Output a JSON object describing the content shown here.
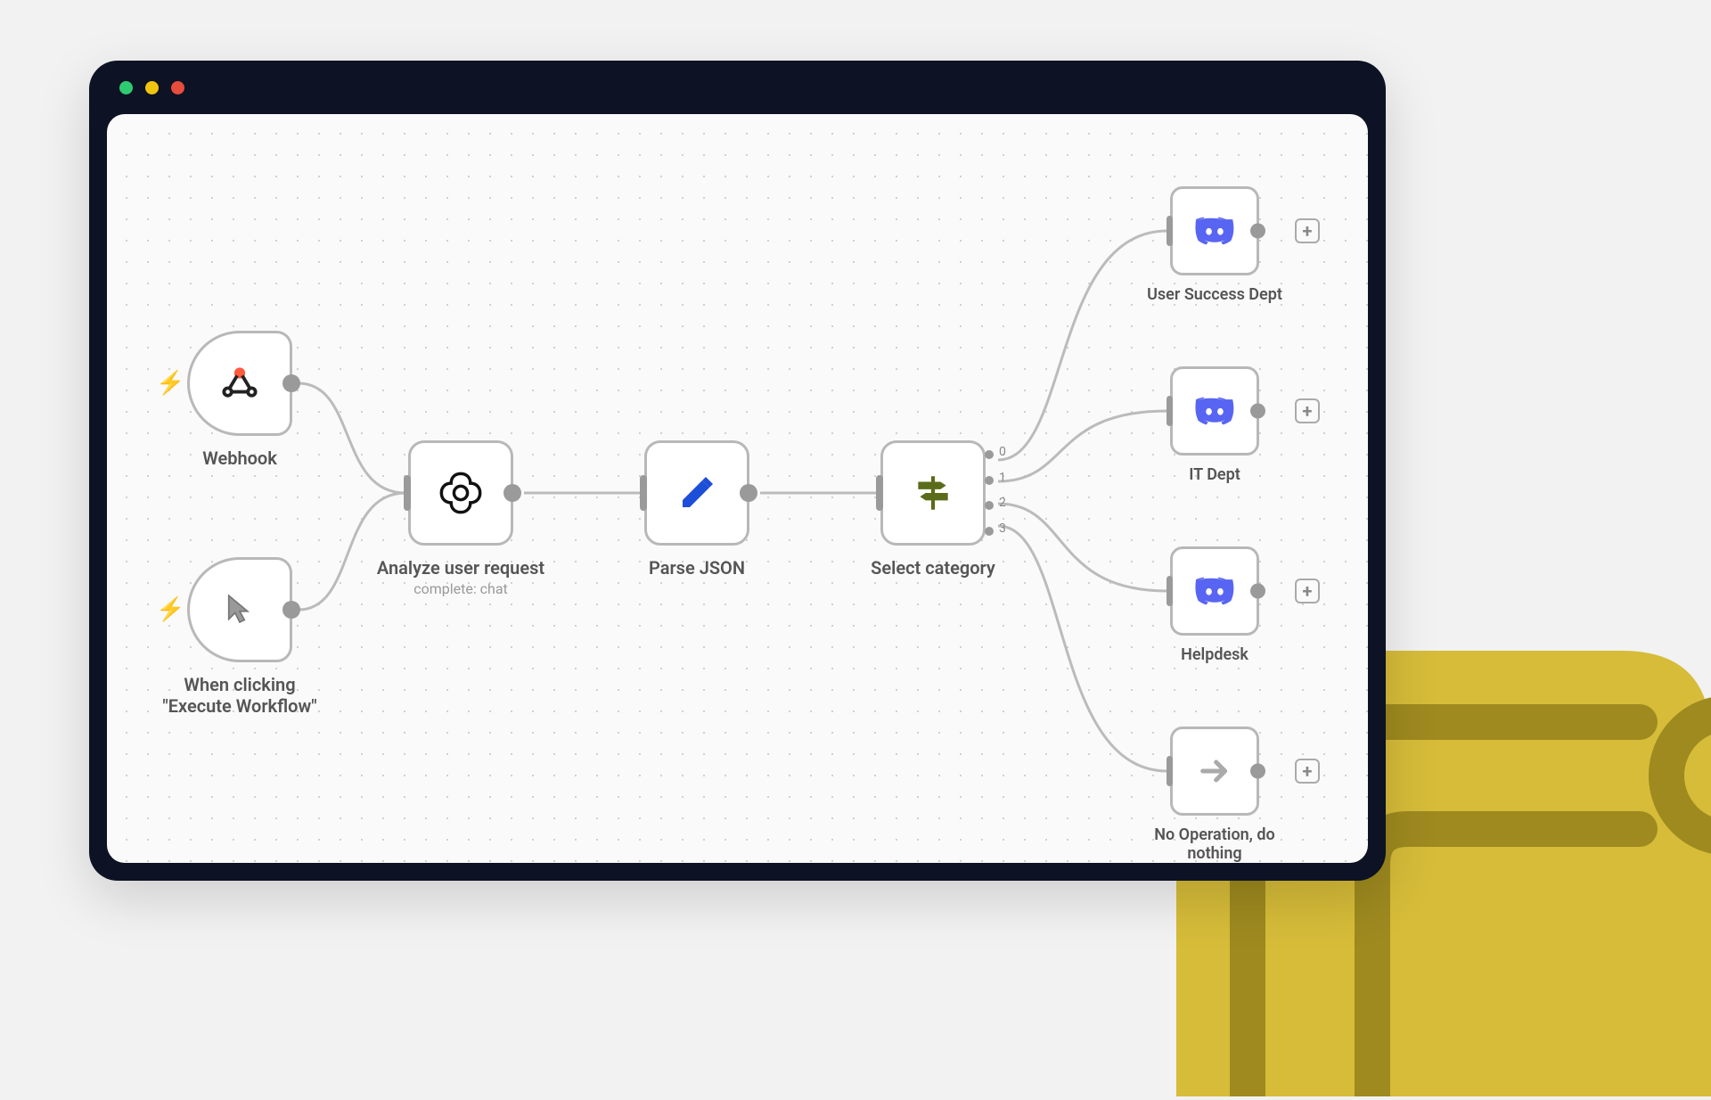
{
  "nodes": {
    "webhook": {
      "label": "Webhook"
    },
    "manual": {
      "label": "When clicking \"Execute Workflow\""
    },
    "analyze": {
      "label": "Analyze user request",
      "sublabel": "complete: chat"
    },
    "parse": {
      "label": "Parse JSON"
    },
    "switch": {
      "label": "Select category",
      "outputs": [
        "0",
        "1",
        "2",
        "3"
      ]
    },
    "out0": {
      "label": "User Success Dept"
    },
    "out1": {
      "label": "IT Dept"
    },
    "out2": {
      "label": "Helpdesk"
    },
    "out3": {
      "label": "No Operation, do nothing"
    }
  },
  "colors": {
    "accent_orange": "#ff5a3c",
    "discord": "#5865F2",
    "pen": "#1d4ed8",
    "signpost": "#4d5e14",
    "decoration": "#d4b82e"
  }
}
